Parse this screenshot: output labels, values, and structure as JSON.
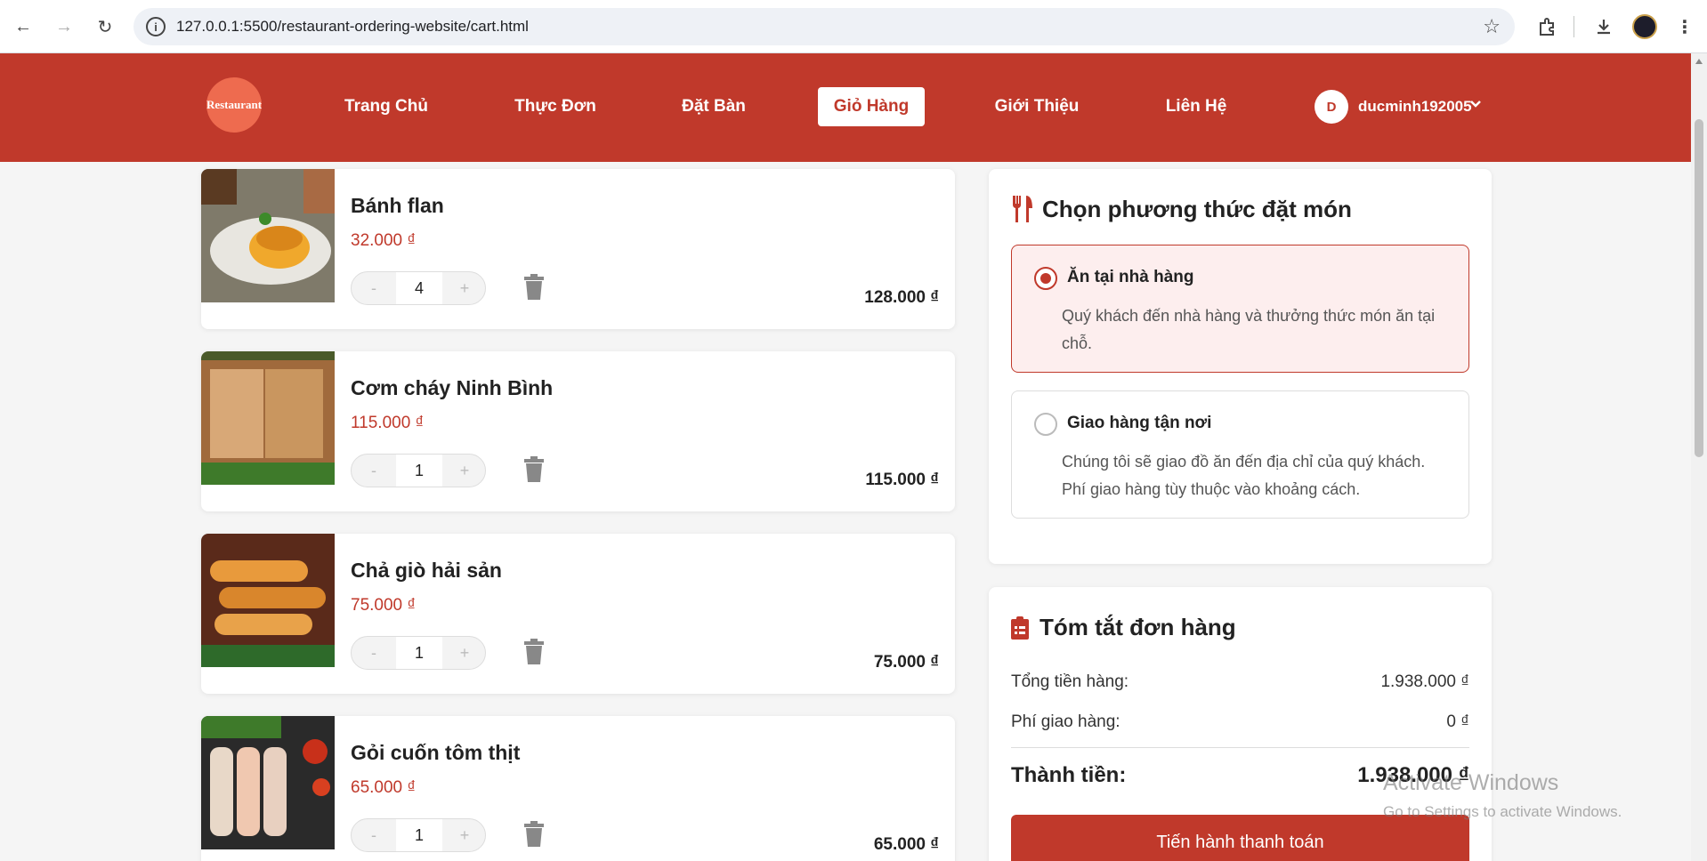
{
  "browser": {
    "url": "127.0.0.1:5500/restaurant-ordering-website/cart.html"
  },
  "header": {
    "logo_text": "Restaurant",
    "nav": [
      {
        "label": "Trang Chủ"
      },
      {
        "label": "Thực Đơn"
      },
      {
        "label": "Đặt Bàn"
      },
      {
        "label": "Giỏ Hàng",
        "active": true
      },
      {
        "label": "Giới Thiệu"
      },
      {
        "label": "Liên Hệ"
      }
    ],
    "user": {
      "initial": "D",
      "name": "ducminh192005"
    }
  },
  "cart": {
    "items": [
      {
        "name": "Bánh flan",
        "price": "32.000 ₫",
        "qty": "4",
        "total": "128.000 ₫",
        "image": "flan-image"
      },
      {
        "name": "Cơm cháy Ninh Bình",
        "price": "115.000 ₫",
        "qty": "1",
        "total": "115.000 ₫",
        "image": "com-chay-image"
      },
      {
        "name": "Chả giò hải sản",
        "price": "75.000 ₫",
        "qty": "1",
        "total": "75.000 ₫",
        "image": "cha-gio-image"
      },
      {
        "name": "Gỏi cuốn tôm thịt",
        "price": "65.000 ₫",
        "qty": "1",
        "total": "65.000 ₫",
        "image": "goi-cuon-image"
      }
    ],
    "minus_label": "-",
    "plus_label": "+"
  },
  "order_method": {
    "title": "Chọn phương thức đặt món",
    "icon": "utensils-icon",
    "options": [
      {
        "title": "Ăn tại nhà hàng",
        "desc": "Quý khách đến nhà hàng và thưởng thức món ăn tại chỗ.",
        "selected": true
      },
      {
        "title": "Giao hàng tận nơi",
        "desc": "Chúng tôi sẽ giao đồ ăn đến địa chỉ của quý khách. Phí giao hàng tùy thuộc vào khoảng cách.",
        "selected": false
      }
    ]
  },
  "summary": {
    "title": "Tóm tắt đơn hàng",
    "icon": "clipboard-list-icon",
    "subtotal_label": "Tổng tiền hàng:",
    "subtotal_value": "1.938.000 ₫",
    "shipping_label": "Phí giao hàng:",
    "shipping_value": "0 ₫",
    "total_label": "Thành tiền:",
    "total_value": "1.938.000 ₫",
    "checkout_label": "Tiến hành thanh toán"
  },
  "watermark": {
    "line1": "Activate Windows",
    "line2": "Go to Settings to activate Windows."
  },
  "colors": {
    "brand": "#c0392b",
    "logo": "#ee6b4f",
    "selected_bg": "#fdeeee"
  }
}
